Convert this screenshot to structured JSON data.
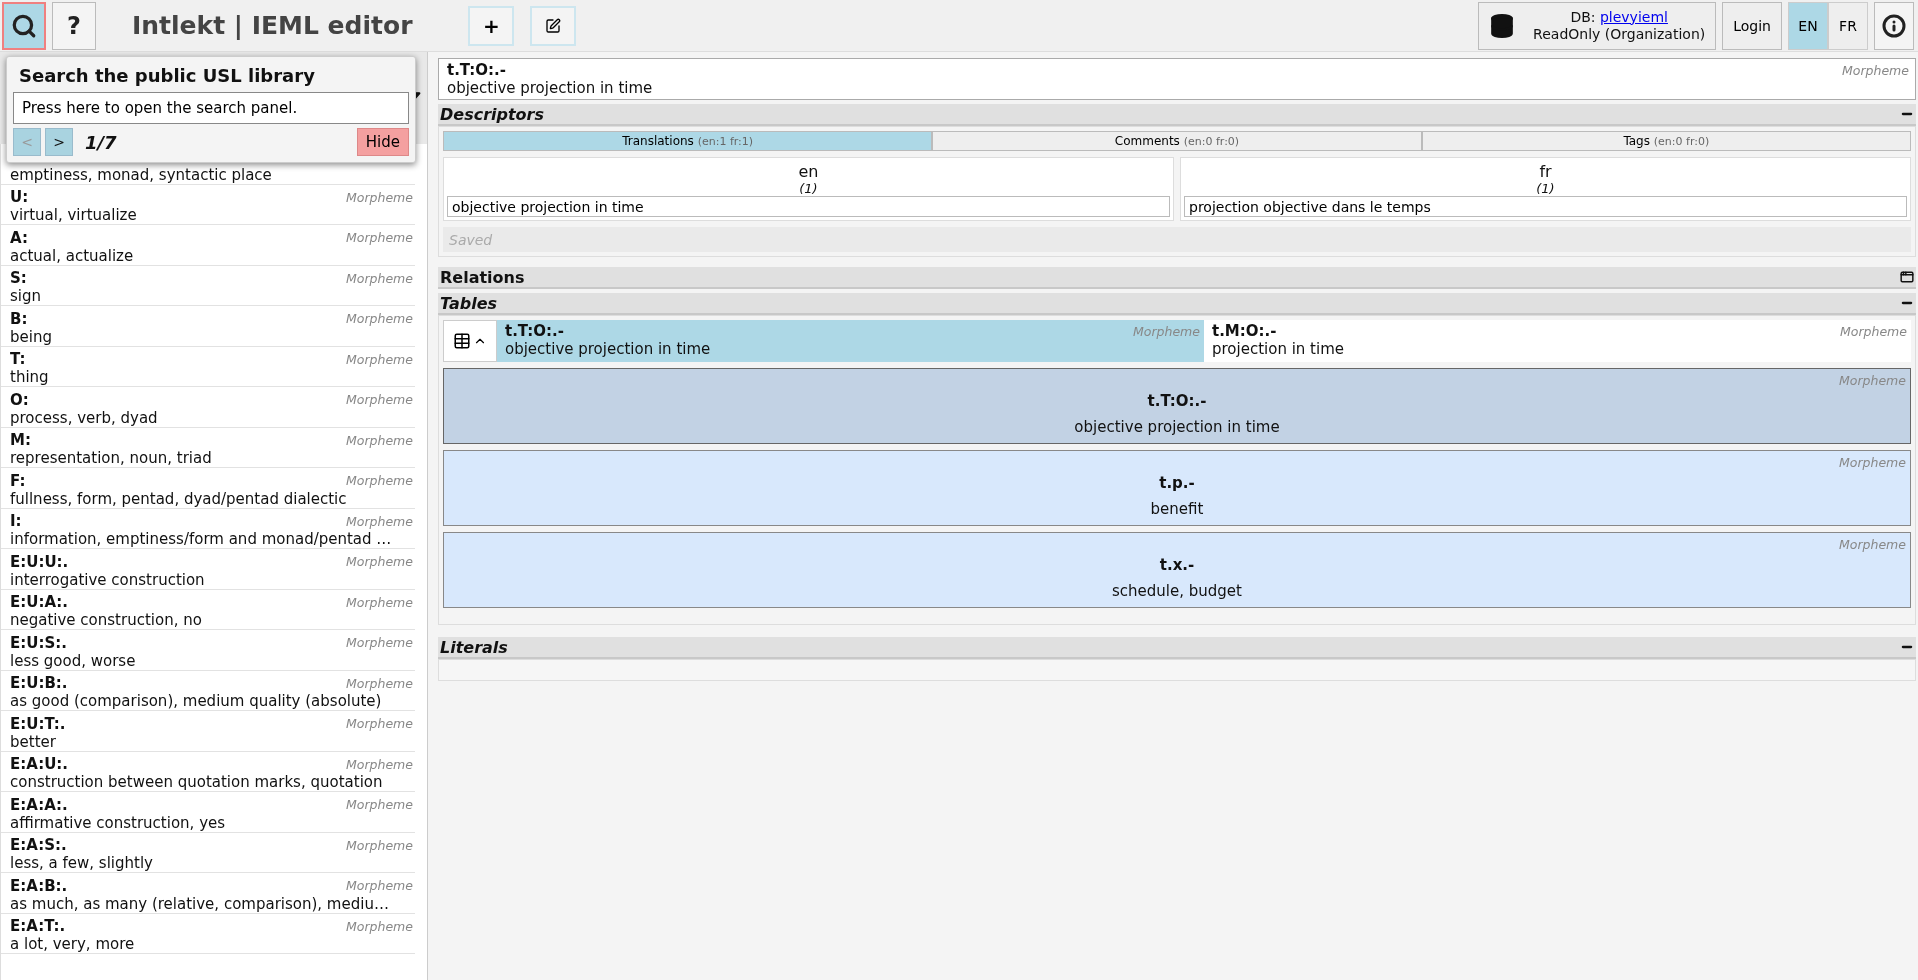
{
  "header": {
    "search_button": {
      "selected": true
    },
    "help_button": "?",
    "title": "Intlekt | IEML editor",
    "add_button": "+",
    "db": {
      "label": "DB:",
      "name": "plevyieml",
      "mode": "ReadOnly (Organization)"
    },
    "login": "Login",
    "languages": [
      {
        "label": "EN",
        "selected": true
      },
      {
        "label": "FR",
        "selected": false
      }
    ]
  },
  "search_popup": {
    "title": "Search the public USL library",
    "value": "Press here to open the search panel.",
    "prev": {
      "label": "<",
      "disabled": true
    },
    "next": {
      "label": ">",
      "disabled": false
    },
    "counter": "1/7",
    "hide": "Hide"
  },
  "sidebar": {
    "items": [
      {
        "description": "emptiness, monad, syntactic place"
      },
      {
        "code": "U:",
        "type": "Morpheme",
        "description": "virtual, virtualize"
      },
      {
        "code": "A:",
        "type": "Morpheme",
        "description": "actual, actualize"
      },
      {
        "code": "S:",
        "type": "Morpheme",
        "description": "sign"
      },
      {
        "code": "B:",
        "type": "Morpheme",
        "description": "being"
      },
      {
        "code": "T:",
        "type": "Morpheme",
        "description": "thing"
      },
      {
        "code": "O:",
        "type": "Morpheme",
        "description": "process, verb, dyad"
      },
      {
        "code": "M:",
        "type": "Morpheme",
        "description": "representation, noun, triad"
      },
      {
        "code": "F:",
        "type": "Morpheme",
        "description": "fullness, form, pentad, dyad/pentad dialectic"
      },
      {
        "code": "I:",
        "type": "Morpheme",
        "description": "information, emptiness/form and monad/pentad …"
      },
      {
        "code": "E:U:U:.",
        "type": "Morpheme",
        "description": "interrogative construction"
      },
      {
        "code": "E:U:A:.",
        "type": "Morpheme",
        "description": "negative construction, no"
      },
      {
        "code": "E:U:S:.",
        "type": "Morpheme",
        "description": "less good, worse"
      },
      {
        "code": "E:U:B:.",
        "type": "Morpheme",
        "description": "as good (comparison), medium quality (absolute)"
      },
      {
        "code": "E:U:T:.",
        "type": "Morpheme",
        "description": "better"
      },
      {
        "code": "E:A:U:.",
        "type": "Morpheme",
        "description": "construction between quotation marks, quotation"
      },
      {
        "code": "E:A:A:.",
        "type": "Morpheme",
        "description": "affirmative construction, yes"
      },
      {
        "code": "E:A:S:.",
        "type": "Morpheme",
        "description": "less, a few, slightly"
      },
      {
        "code": "E:A:B:.",
        "type": "Morpheme",
        "description": "as much, as many (relative, comparison), mediu…"
      },
      {
        "code": "E:A:T:.",
        "type": "Morpheme",
        "description": "a lot, very, more"
      }
    ]
  },
  "entry": {
    "code": "t.T:O:.-",
    "type": "Morpheme",
    "description": "objective projection in time"
  },
  "descriptors": {
    "title": "Descriptors",
    "expanded": true,
    "tabs": [
      {
        "label": "Translations",
        "counts": "(en:1 fr:1)",
        "selected": true
      },
      {
        "label": "Comments",
        "counts": "(en:0 fr:0)",
        "selected": false
      },
      {
        "label": "Tags",
        "counts": "(en:0 fr:0)",
        "selected": false
      }
    ],
    "translations": [
      {
        "lang": "en",
        "count": "(1)",
        "value": "objective projection in time"
      },
      {
        "lang": "fr",
        "count": "(1)",
        "value": "projection objective dans le temps"
      }
    ],
    "status": "Saved"
  },
  "relations": {
    "title": "Relations",
    "expanded": false
  },
  "tables": {
    "title": "Tables",
    "expanded": true,
    "header_cells": [
      {
        "code": "t.T:O:.-",
        "type": "Morpheme",
        "description": "objective projection in time",
        "selected": true
      },
      {
        "code": "t.M:O:.-",
        "type": "Morpheme",
        "description": "projection in time",
        "selected": false
      }
    ],
    "rows": [
      {
        "code": "t.T:O:.-",
        "type": "Morpheme",
        "description": "objective projection in time",
        "selected": true
      },
      {
        "code": "t.p.-",
        "type": "Morpheme",
        "description": "benefit",
        "selected": false
      },
      {
        "code": "t.x.-",
        "type": "Morpheme",
        "description": "schedule, budget",
        "selected": false
      }
    ]
  },
  "literals": {
    "title": "Literals",
    "expanded": true
  }
}
